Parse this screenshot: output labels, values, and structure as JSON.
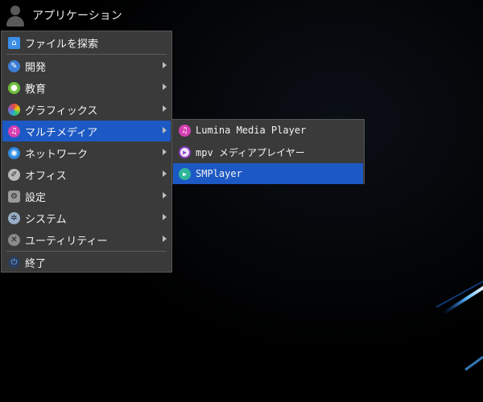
{
  "panel": {
    "app_label": "アプリケーション",
    "icon": "user-icon"
  },
  "main_menu": {
    "search_label": "ファイルを探索",
    "items": [
      {
        "label": "開発",
        "icon": "wrench-icon",
        "color": "#3d7fd6",
        "has_submenu": true
      },
      {
        "label": "教育",
        "icon": "education-icon",
        "color": "#6fbf3c",
        "has_submenu": true
      },
      {
        "label": "グラフィックス",
        "icon": "graphics-icon",
        "color": "#e08a3a",
        "has_submenu": true
      },
      {
        "label": "マルチメディア",
        "icon": "music-icon",
        "color": "#d63fb2",
        "has_submenu": true,
        "active": true
      },
      {
        "label": "ネットワーク",
        "icon": "network-icon",
        "color": "#2f8ae0",
        "has_submenu": true
      },
      {
        "label": "オフィス",
        "icon": "office-icon",
        "color": "#9a9a9a",
        "has_submenu": true
      },
      {
        "label": "設定",
        "icon": "settings-icon",
        "color": "#8a8a8a",
        "has_submenu": true
      },
      {
        "label": "システム",
        "icon": "system-icon",
        "color": "#9ab0c8",
        "has_submenu": true
      },
      {
        "label": "ユーティリティー",
        "icon": "utilities-icon",
        "color": "#8a8a8a",
        "has_submenu": true
      }
    ],
    "quit_label": "終了"
  },
  "sub_menu": {
    "items": [
      {
        "label": "Lumina Media Player",
        "icon": "music-icon",
        "color": "#d63fb2"
      },
      {
        "label": "mpv メディアプレイヤー",
        "icon": "mpv-icon",
        "color": "#8e3fc8"
      },
      {
        "label": "SMPlayer",
        "icon": "smplayer-icon",
        "color": "#2fb59a",
        "active": true
      }
    ]
  }
}
